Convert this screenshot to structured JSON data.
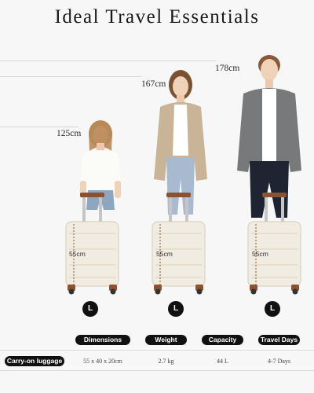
{
  "title": "Ideal Travel Essentials",
  "figures": [
    {
      "name": "child",
      "height_label": "125cm",
      "case_height_label": "55cm",
      "size": "L"
    },
    {
      "name": "woman",
      "height_label": "167cm",
      "case_height_label": "55cm",
      "size": "L"
    },
    {
      "name": "man",
      "height_label": "178cm",
      "case_height_label": "55cm",
      "size": "L"
    }
  ],
  "specs": {
    "row_label": "Carry-on luggage",
    "headers": [
      "Dimensions",
      "Weight",
      "Capacity",
      "Travel Days"
    ],
    "values": [
      "55 x 40 x 20cm",
      "2.7 kg",
      "44 L",
      "4-7 Days"
    ]
  },
  "colors": {
    "background": "#f7f7f7",
    "suitcase_shell": "#f1ece1",
    "suitcase_trim": "#8a5230",
    "badge": "#111111"
  }
}
